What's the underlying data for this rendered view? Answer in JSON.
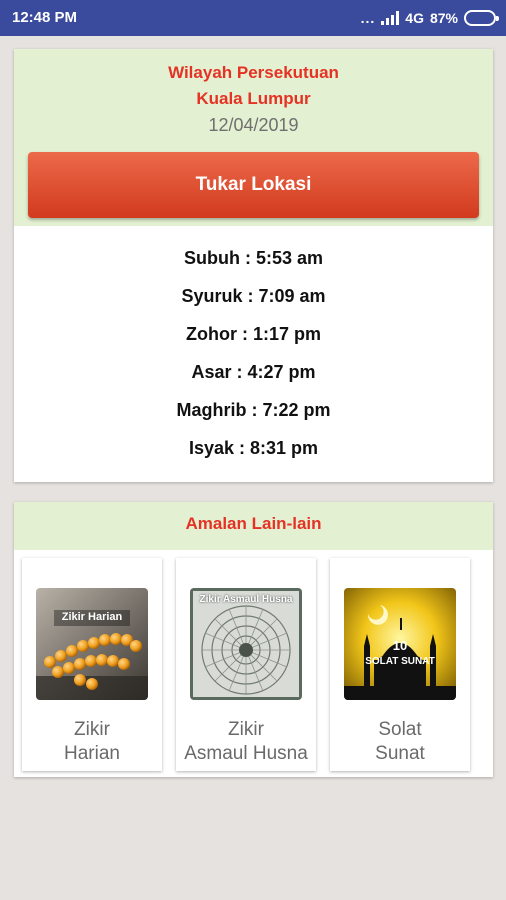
{
  "status_bar": {
    "time": "12:48 PM",
    "dots": "...",
    "network": "4G",
    "battery": "87%",
    "battery_level": 0.87
  },
  "location_card": {
    "region_line1": "Wilayah Persekutuan",
    "region_line2": "Kuala Lumpur",
    "date": "12/04/2019",
    "change_location_button": "Tukar Lokasi",
    "prayer_times": [
      "Subuh : 5:53 am",
      "Syuruk : 7:09 am",
      "Zohor : 1:17 pm",
      "Asar : 4:27 pm",
      "Maghrib : 7:22 pm",
      "Isyak : 8:31 pm"
    ]
  },
  "other_practices": {
    "title": "Amalan Lain-lain",
    "items": [
      {
        "label_line1": "Zikir",
        "label_line2": "Harian",
        "image_text": "Zikir Harian",
        "icon": "prayer-beads-icon"
      },
      {
        "label_line1": "Zikir",
        "label_line2": "Asmaul Husna",
        "image_text": "Zikir Asmaul Husna",
        "icon": "islamic-pattern-icon"
      },
      {
        "label_line1": "Solat",
        "label_line2": "Sunat",
        "image_text_line1": "10",
        "image_text_line2": "SOLAT SUNAT",
        "icon": "mosque-icon"
      }
    ]
  },
  "colors": {
    "status_bar": "#3a4a9c",
    "header_bg": "#e3f1d2",
    "accent_red": "#e53224",
    "button_top": "#ec6a4a",
    "button_bottom": "#d23a1e"
  }
}
